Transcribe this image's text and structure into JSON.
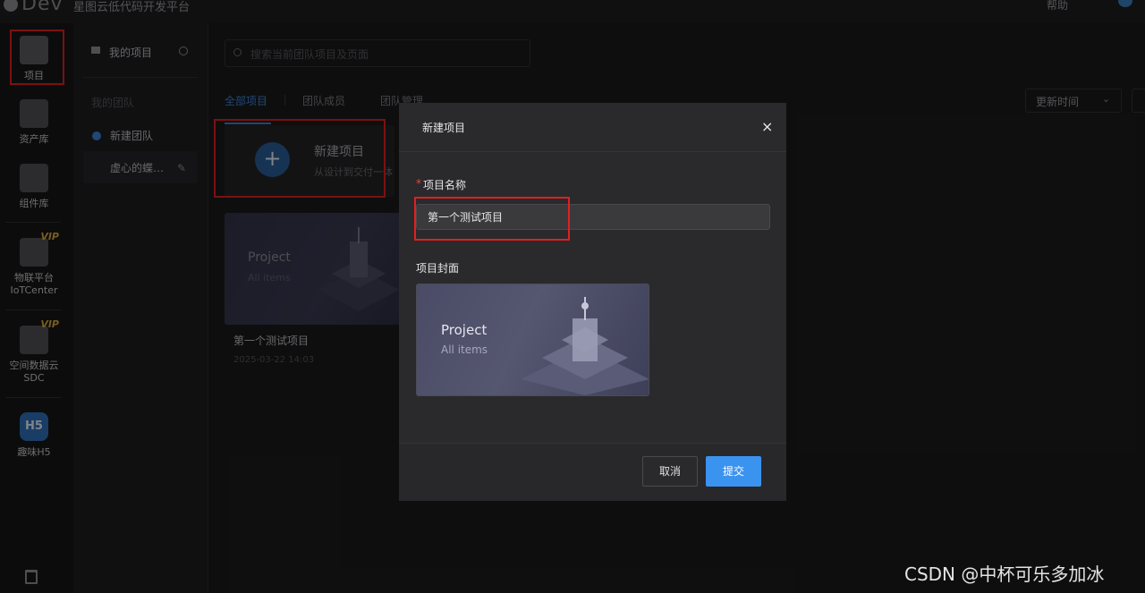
{
  "topbar": {
    "logo": "Dev",
    "app_title": "星图云低代码开发平台",
    "help": "帮助"
  },
  "rail": {
    "items": [
      {
        "label": "项目"
      },
      {
        "label": "资产库"
      },
      {
        "label": "组件库"
      },
      {
        "label": "物联平台",
        "sublabel": "IoTCenter",
        "badge": "VIP"
      },
      {
        "label": "空间数据云",
        "sublabel": "SDC",
        "badge": "VIP"
      },
      {
        "label": "趣味H5",
        "icon_text": "H5"
      }
    ]
  },
  "sidebar": {
    "my_projects": "我的项目",
    "my_team": "我的团队",
    "new_team": "新建团队",
    "team_item": "虚心的蝶…"
  },
  "main": {
    "search_placeholder": "搜索当前团队项目及页面",
    "tabs": [
      {
        "label": "全部项目"
      },
      {
        "label": "团队成员"
      },
      {
        "label": "团队管理"
      }
    ],
    "sort_label": "更新时间",
    "new_project_card": {
      "title": "新建项目",
      "subtitle": "从设计到交付一体"
    },
    "project_card": {
      "thumb_title": "Project",
      "thumb_sub": "All items",
      "name": "第一个测试项目",
      "date": "2025-03-22 14:03"
    }
  },
  "modal": {
    "title": "新建项目",
    "close": "×",
    "name_label": "项目名称",
    "required_mark": "*",
    "name_value": "第一个测试项目",
    "cover_label": "项目封面",
    "cover_title": "Project",
    "cover_sub": "All items",
    "cancel": "取消",
    "submit": "提交"
  },
  "watermark": "CSDN @中杯可乐多加冰",
  "colors": {
    "accent": "#3b93f0",
    "highlight": "#e0201f",
    "background": "#1b1b1d"
  }
}
